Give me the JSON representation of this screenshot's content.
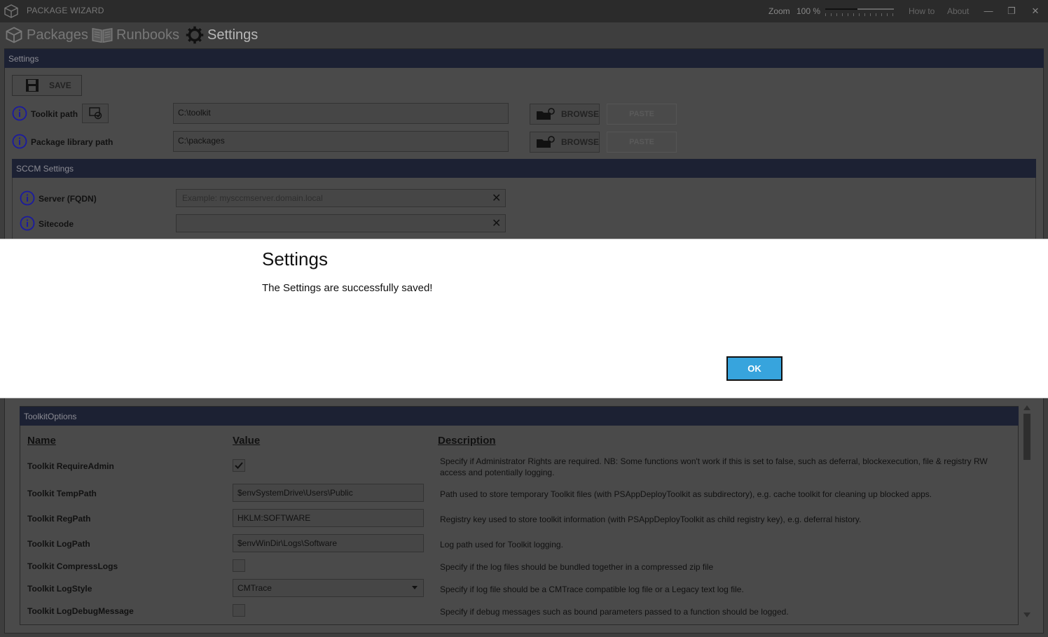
{
  "window": {
    "title": "PACKAGE WIZARD",
    "zoom_label": "Zoom",
    "zoom_value": "100 %",
    "zoom_level_percent": 100,
    "how_to": "How to",
    "about": "About",
    "minimize_glyph": "—",
    "maximize_glyph": "❐",
    "close_glyph": "✕"
  },
  "nav": {
    "tabs": [
      {
        "label": "Packages",
        "icon": "package-icon"
      },
      {
        "label": "Runbooks",
        "icon": "book-icon"
      },
      {
        "label": "Settings",
        "icon": "gear-icon",
        "active": true
      }
    ]
  },
  "settings": {
    "header": "Settings",
    "save_label": "SAVE",
    "toolkit_path": {
      "label": "Toolkit path",
      "value": "C:\\toolkit"
    },
    "package_library_path": {
      "label": "Package library path",
      "value": "C:\\packages"
    },
    "browse_label": "BROWSE",
    "paste_label": "PASTE"
  },
  "sccm": {
    "header": "SCCM Settings",
    "server": {
      "label": "Server (FQDN)",
      "placeholder": "Example: mysccmserver.domain.local",
      "value": ""
    },
    "sitecode": {
      "label": "Sitecode",
      "value": ""
    }
  },
  "toolkit_options": {
    "header": "ToolkitOptions",
    "columns": {
      "name": "Name",
      "value": "Value",
      "description": "Description"
    },
    "rows": [
      {
        "name": "Toolkit RequireAdmin",
        "type": "checkbox",
        "checked": true,
        "description": "Specify if Administrator Rights are required. NB: Some functions won't work if this is set to false, such as deferral, blockexecution, file & registry RW access and potentially logging."
      },
      {
        "name": "Toolkit TempPath",
        "type": "text",
        "value": "$envSystemDrive\\Users\\Public",
        "description": "Path used to store temporary Toolkit files (with PSAppDeployToolkit as subdirectory), e.g. cache toolkit for cleaning up blocked apps."
      },
      {
        "name": "Toolkit RegPath",
        "type": "text",
        "value": "HKLM:SOFTWARE",
        "description": "Registry key used to store toolkit information (with PSAppDeployToolkit as child registry key), e.g. deferral history."
      },
      {
        "name": "Toolkit LogPath",
        "type": "text",
        "value": "$envWinDir\\Logs\\Software",
        "description": "Log path used for Toolkit logging."
      },
      {
        "name": "Toolkit CompressLogs",
        "type": "checkbox",
        "checked": false,
        "description": "Specify if the log files should be bundled together in a compressed zip file"
      },
      {
        "name": "Toolkit LogStyle",
        "type": "select",
        "value": "CMTrace",
        "description": "Specify if log file should be a CMTrace compatible log file or a Legacy text log file."
      },
      {
        "name": "Toolkit LogDebugMessage",
        "type": "checkbox",
        "checked": false,
        "description": "Specify if debug messages such as bound parameters passed to a function should be logged."
      }
    ]
  },
  "dialog": {
    "title": "Settings",
    "message": "The Settings are successfully saved!",
    "ok_label": "OK"
  },
  "colors": {
    "header_bar": "#1c2133",
    "ok_button": "#37a4dd",
    "info_icon": "#1a1aa0"
  }
}
